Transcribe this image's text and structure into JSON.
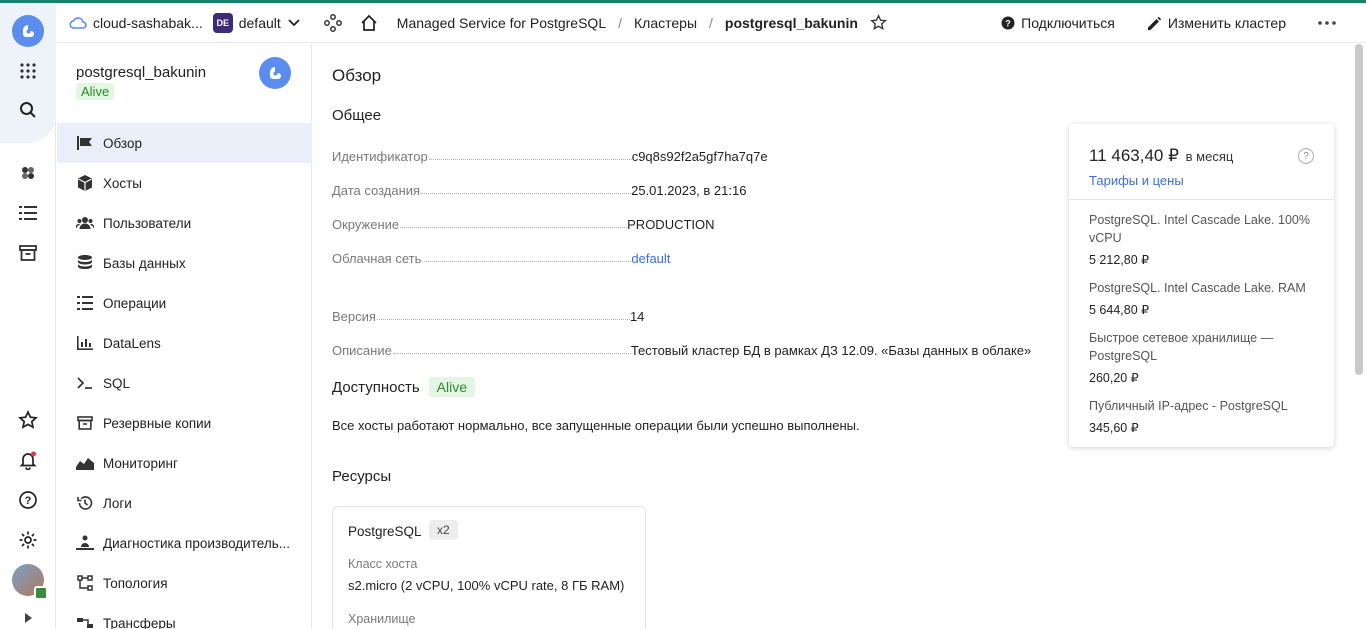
{
  "header": {
    "cloud_name": "cloud-sashabak...",
    "folder_badge": "DE",
    "folder_name": "default",
    "breadcrumbs": [
      "Managed Service for PostgreSQL",
      "Кластеры",
      "postgresql_bakunin"
    ],
    "connect_label": "Подключиться",
    "edit_label": "Изменить кластер"
  },
  "sidebar": {
    "cluster_name": "postgresql_bakunin",
    "status": "Alive",
    "items": [
      {
        "label": "Обзор",
        "icon": "overview-icon"
      },
      {
        "label": "Хосты",
        "icon": "hosts-icon"
      },
      {
        "label": "Пользователи",
        "icon": "users-icon"
      },
      {
        "label": "Базы данных",
        "icon": "database-icon"
      },
      {
        "label": "Операции",
        "icon": "operations-icon"
      },
      {
        "label": "DataLens",
        "icon": "datalens-icon"
      },
      {
        "label": "SQL",
        "icon": "sql-icon"
      },
      {
        "label": "Резервные копии",
        "icon": "backups-icon"
      },
      {
        "label": "Мониторинг",
        "icon": "monitoring-icon"
      },
      {
        "label": "Логи",
        "icon": "logs-icon"
      },
      {
        "label": "Диагностика производитель...",
        "icon": "diagnostics-icon"
      },
      {
        "label": "Топология",
        "icon": "topology-icon"
      },
      {
        "label": "Трансферы",
        "icon": "transfers-icon"
      }
    ]
  },
  "main": {
    "page_title": "Обзор",
    "general_title": "Общее",
    "fields": [
      {
        "key": "Идентификатор",
        "value": "c9q8s92f2a5gf7ha7q7e"
      },
      {
        "key": "Дата создания",
        "value": "25.01.2023, в 21:16"
      },
      {
        "key": "Окружение",
        "value": "PRODUCTION"
      },
      {
        "key": "Облачная сеть",
        "value": "default"
      },
      {
        "key": "Версия",
        "value": "14"
      },
      {
        "key": "Описание",
        "value": "Тестовый кластер БД в рамках ДЗ 12.09. «Базы данных в облаке»"
      }
    ],
    "availability_title": "Доступность",
    "availability_status": "Alive",
    "availability_text": "Все хосты работают нормально, все запущенные операции были успешно выполнены.",
    "resources_title": "Ресурсы",
    "resource": {
      "name": "PostgreSQL",
      "count": "x2",
      "host_class_label": "Класс хоста",
      "host_class_name": "s2.micro",
      "host_class_detail": " (2 vCPU, 100% vCPU rate, 8 ГБ RAM)",
      "storage_label": "Хранилище"
    }
  },
  "pricing": {
    "total": "11 463,40 ₽",
    "period": "в месяц",
    "help": "?",
    "link": "Тарифы и цены",
    "items": [
      {
        "name": "PostgreSQL. Intel Cascade Lake. 100% vCPU",
        "price": "5 212,80 ₽"
      },
      {
        "name": "PostgreSQL. Intel Cascade Lake. RAM",
        "price": "5 644,80 ₽"
      },
      {
        "name": "Быстрое сетевое хранилище — PostgreSQL",
        "price": "260,20 ₽"
      },
      {
        "name": "Публичный IP-адрес - PostgreSQL",
        "price": "345,60 ₽"
      }
    ]
  },
  "colors": {
    "accent": "#5b8def",
    "link": "#3a6fd8",
    "alive_bg": "#e3f5e3",
    "alive_text": "#2e8b2e",
    "folder_badge": "#3e2b7a"
  }
}
